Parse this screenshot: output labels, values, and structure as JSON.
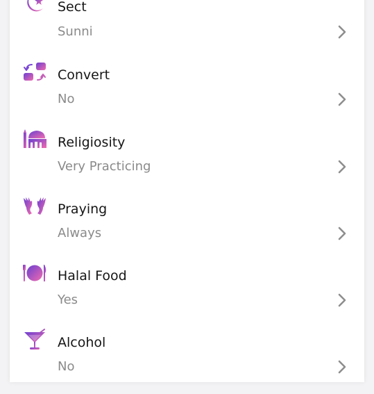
{
  "colors": {
    "icon_gradient_start": "#6a3fd0",
    "icon_gradient_end": "#f06bb0",
    "label": "#161616",
    "value": "#8a8a8a",
    "chevron": "#8e8e8e"
  },
  "items": [
    {
      "label": "Sect",
      "value": "Sunni",
      "icon": "crescent-star-icon"
    },
    {
      "label": "Convert",
      "value": "No",
      "icon": "convert-arrows-icon"
    },
    {
      "label": "Religiosity",
      "value": "Very Practicing",
      "icon": "mosque-icon"
    },
    {
      "label": "Praying",
      "value": "Always",
      "icon": "praying-hands-icon"
    },
    {
      "label": "Halal Food",
      "value": "Yes",
      "icon": "plate-cutlery-icon"
    },
    {
      "label": "Alcohol",
      "value": "No",
      "icon": "cocktail-glass-icon"
    }
  ]
}
